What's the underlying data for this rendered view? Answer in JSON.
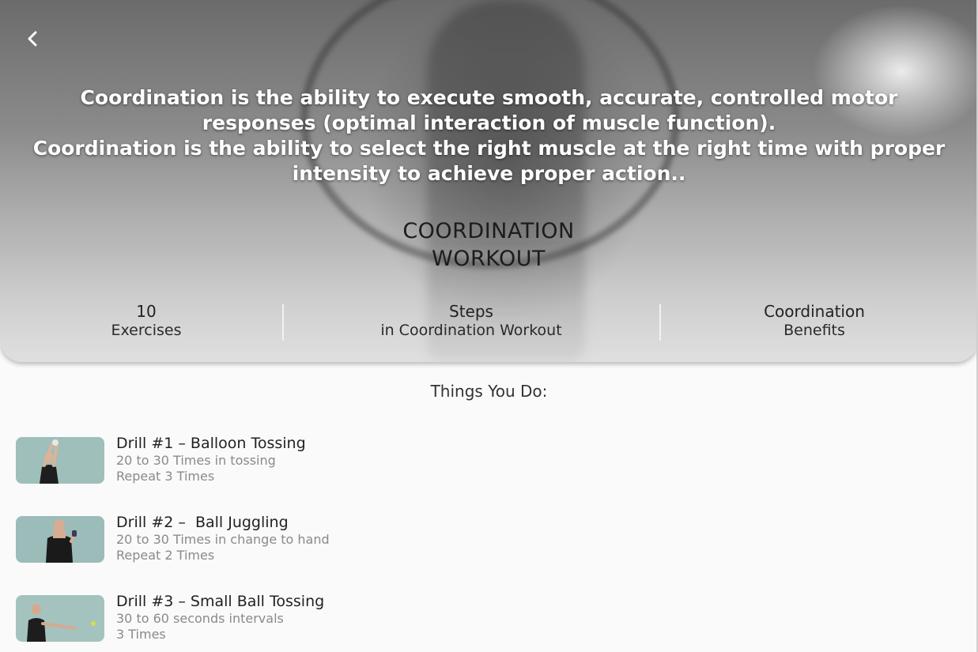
{
  "header": {
    "intro_line1": "Coordination is the ability to execute smooth, accurate, controlled motor responses (optimal interaction of muscle function).",
    "intro_line2": "Coordination is the ability to select the right muscle at the right time with proper intensity to achieve proper action..",
    "title_line1": "COORDINATION",
    "title_line2": "WORKOUT"
  },
  "stats": [
    {
      "value": "10",
      "label": "Exercises"
    },
    {
      "value": "Steps",
      "label": "in Coordination Workout"
    },
    {
      "value": "Coordination",
      "label": "Benefits"
    }
  ],
  "section_title": "Things You Do:",
  "drills": [
    {
      "name": "Drill #1 – Balloon Tossing",
      "line1": "20 to 30 Times in tossing",
      "line2": "Repeat 3 Times"
    },
    {
      "name": "Drill #2 –  Ball Juggling",
      "line1": "20 to 30 Times in change to hand",
      "line2": "Repeat 2 Times"
    },
    {
      "name": "Drill #3 – Small Ball Tossing",
      "line1": "30 to 60 seconds intervals",
      "line2": "3 Times"
    }
  ],
  "icons": {
    "back": "chevron-left-icon"
  },
  "colors": {
    "accent": "#ffffff",
    "background": "#fafafa",
    "secondary_text": "#8a8a8a"
  }
}
